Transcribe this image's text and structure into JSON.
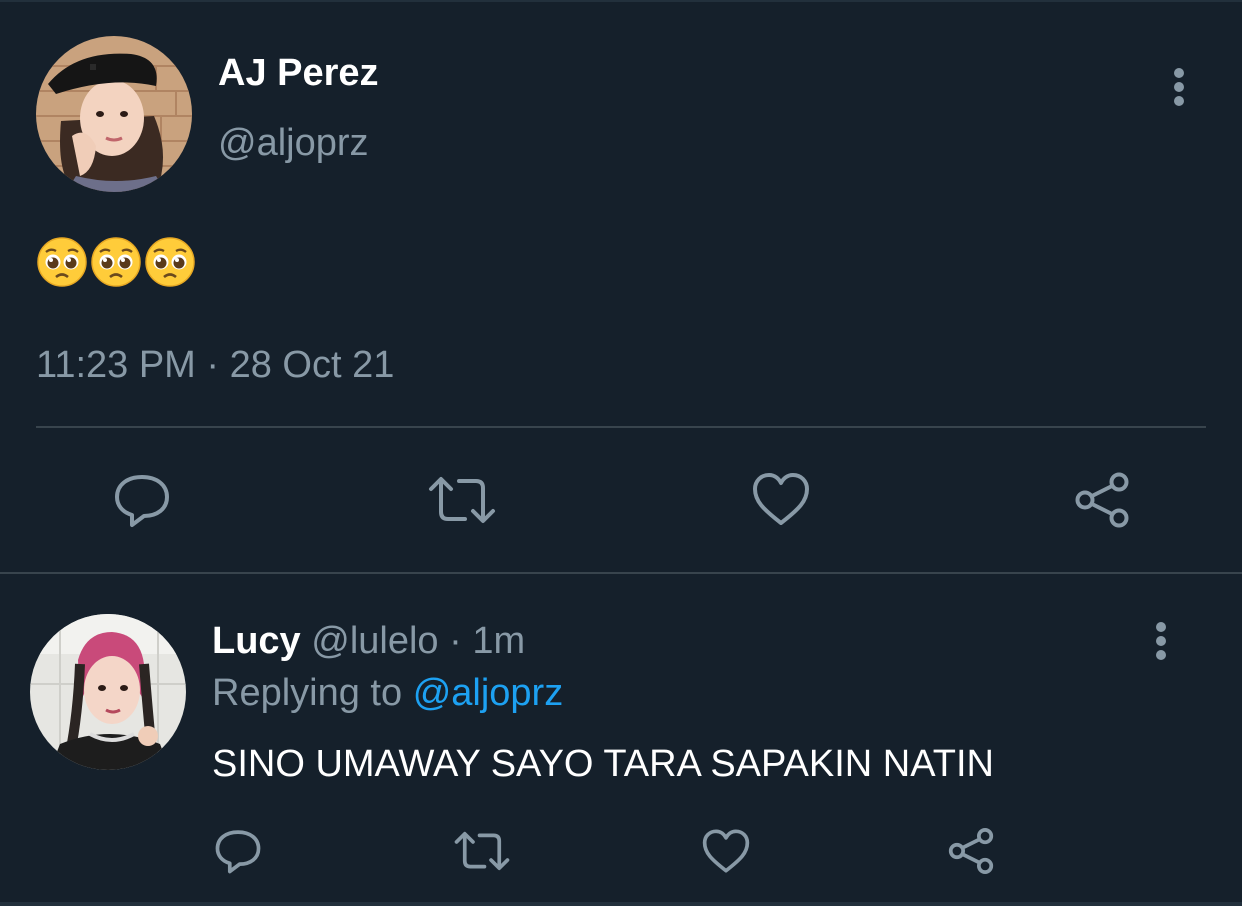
{
  "tweet": {
    "author_name": "AJ Perez",
    "author_handle": "@aljoprz",
    "body_emojis": [
      "pleading-face",
      "pleading-face",
      "pleading-face"
    ],
    "timestamp": "11:23 PM · 28 Oct 21",
    "actions": [
      "reply",
      "retweet",
      "like",
      "share"
    ]
  },
  "reply": {
    "author_name": "Lucy",
    "author_handle": "@lulelo",
    "age": "· 1m",
    "replying_label": "Replying to",
    "replying_to": "@aljoprz",
    "text": "SINO UMAWAY SAYO TARA SAPAKIN NATIN",
    "actions": [
      "reply",
      "retweet",
      "like",
      "share"
    ]
  },
  "colors": {
    "background": "#15202b",
    "primary_text": "#ffffff",
    "secondary_text": "#8899a6",
    "accent": "#1da1f2",
    "divider": "#38444d"
  },
  "icons": {
    "more": "more-vertical-icon",
    "reply": "reply-icon",
    "retweet": "retweet-icon",
    "like": "heart-icon",
    "share": "share-icon",
    "emoji": "pleading-face-emoji"
  }
}
